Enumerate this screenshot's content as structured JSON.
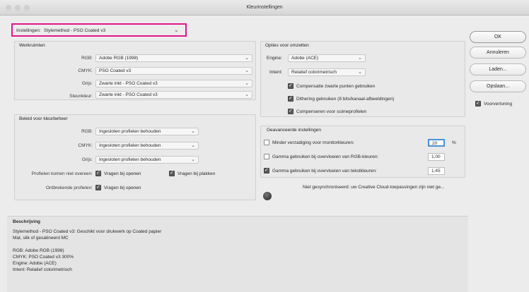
{
  "window": {
    "title": "Kleurinstellingen"
  },
  "preset": {
    "label": "Instellingen:",
    "value": "Stylemethod - PSO Coated v3"
  },
  "workspaces": {
    "title": "Werkruimten",
    "rows": [
      {
        "label": "RGB:",
        "value": "Adobe RGB (1998)"
      },
      {
        "label": "CMYK:",
        "value": "PSO Coated v3"
      },
      {
        "label": "Grijs:",
        "value": "Zwarte inkt - PSO Coated v3"
      },
      {
        "label": "Steunkleur:",
        "value": "Zwarte inkt - PSO Coated v3"
      }
    ]
  },
  "policies": {
    "title": "Beleid voor kleurbeheer",
    "rows": [
      {
        "label": "RGB:",
        "value": "Ingesloten profielen behouden"
      },
      {
        "label": "CMYK:",
        "value": "Ingesloten profielen behouden"
      },
      {
        "label": "Grijs:",
        "value": "Ingesloten profielen behouden"
      }
    ],
    "mismatch_label": "Profielen komen niet overeen:",
    "mismatch_open": "Vragen bij openen",
    "mismatch_paste": "Vragen bij plakken",
    "missing_label": "Ontbrekende profielen:",
    "missing_open": "Vragen bij openen"
  },
  "conversion": {
    "title": "Opties voor omzetten",
    "engine_label": "Engine:",
    "engine_value": "Adobe (ACE)",
    "intent_label": "Intent:",
    "intent_value": "Relatief colorimetrisch",
    "options": [
      {
        "label": "Compensatie zwarte punten gebruiken",
        "checked": true
      },
      {
        "label": "Dithering gebruiken (8 bits/kanaal-afbeeldingen)",
        "checked": true
      },
      {
        "label": "Compenseren voor scèneprofielen",
        "checked": true
      }
    ]
  },
  "advanced": {
    "title": "Geavanceerde instellingen",
    "rows": [
      {
        "label": "Minder verzadiging voor monitorkleuren:",
        "value": "20",
        "unit": "%",
        "checked": false
      },
      {
        "label": "Gamma gebruiken bij overvloeien van RGB-kleuren:",
        "value": "1,00",
        "unit": "",
        "checked": false
      },
      {
        "label": "Gamma gebruiken bij overvloeien van tekstkleuren:",
        "value": "1,45",
        "unit": "",
        "checked": true
      }
    ]
  },
  "sync_notice": "Niet gesynchroniseerd: uw Creative Cloud-toepassingen zijn niet ge...",
  "buttons": {
    "ok": "OK",
    "cancel": "Annuleren",
    "load": "Laden...",
    "save": "Opslaan..."
  },
  "preview": {
    "label": "Voorvertoning",
    "checked": true
  },
  "description": {
    "title": "Beschrijving",
    "lines": [
      "Stylemethod - PSO Coated v3: Geschikt voor drukwerk op Coated papier",
      "Mat, silk of gesatineerd MC",
      "",
      "RGB: Adobe RGB (1998)",
      "CMYK: PSO Coated v3 300%",
      "Engine: Adobe (ACE)",
      "Intent: Relatief colorimetrisch"
    ]
  },
  "colors": {
    "highlight": "#e0168a",
    "background": "#ececec"
  }
}
